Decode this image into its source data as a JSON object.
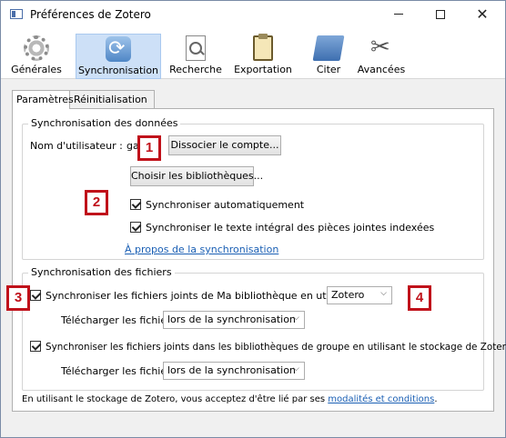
{
  "window": {
    "title": "Préférences de Zotero",
    "minimize_glyph": "—",
    "close_glyph": "✕"
  },
  "toolbar": {
    "items": [
      {
        "label": "Générales",
        "icon": "gear-icon",
        "selected": false
      },
      {
        "label": "Synchronisation",
        "icon": "sync-icon",
        "selected": true
      },
      {
        "label": "Recherche",
        "icon": "search-icon",
        "selected": false
      },
      {
        "label": "Exportation",
        "icon": "clipboard-icon",
        "selected": false
      },
      {
        "label": "Citer",
        "icon": "folder-icon",
        "selected": false
      },
      {
        "label": "Avancées",
        "icon": "tools-icon",
        "selected": false
      }
    ]
  },
  "tabs": [
    {
      "label": "Paramètres",
      "active": true
    },
    {
      "label": "Réinitialisation",
      "active": false
    }
  ],
  "data_sync": {
    "title": "Synchronisation des données",
    "username_label": "Nom d'utilisateur :",
    "username_value": "ga",
    "unlink_button": "Dissocier le compte...",
    "choose_libraries_button": "Choisir les bibliothèques...",
    "auto_sync": {
      "label": "Synchroniser automatiquement",
      "checked": true
    },
    "fulltext_sync": {
      "label": "Synchroniser le texte intégral des pièces jointes indexées",
      "checked": true
    },
    "about_link": "À propos de la synchronisation"
  },
  "file_sync": {
    "title": "Synchronisation des fichiers",
    "my_library": {
      "label": "Synchroniser les fichiers joints de Ma bibliothèque en utilisant",
      "checked": true
    },
    "storage_select": "Zotero",
    "download_label_1": "Télécharger les fichiers",
    "download_select_1": "lors de la synchronisation",
    "group_libraries": {
      "label": "Synchroniser les fichiers joints dans les bibliothèques de groupe en utilisant le stockage de Zotero",
      "checked": true
    },
    "download_label_2": "Télécharger les fichiers",
    "download_select_2": "lors de la synchronisation"
  },
  "footer": {
    "text_before": "En utilisant le stockage de Zotero, vous acceptez d'être lié par ses ",
    "link": "modalités et conditions",
    "text_after": "."
  },
  "callouts": [
    "1",
    "2",
    "3",
    "4"
  ],
  "colors": {
    "callout_red": "#c0111a",
    "selected_bg": "#cde0f7",
    "link": "#1a5fb4"
  }
}
